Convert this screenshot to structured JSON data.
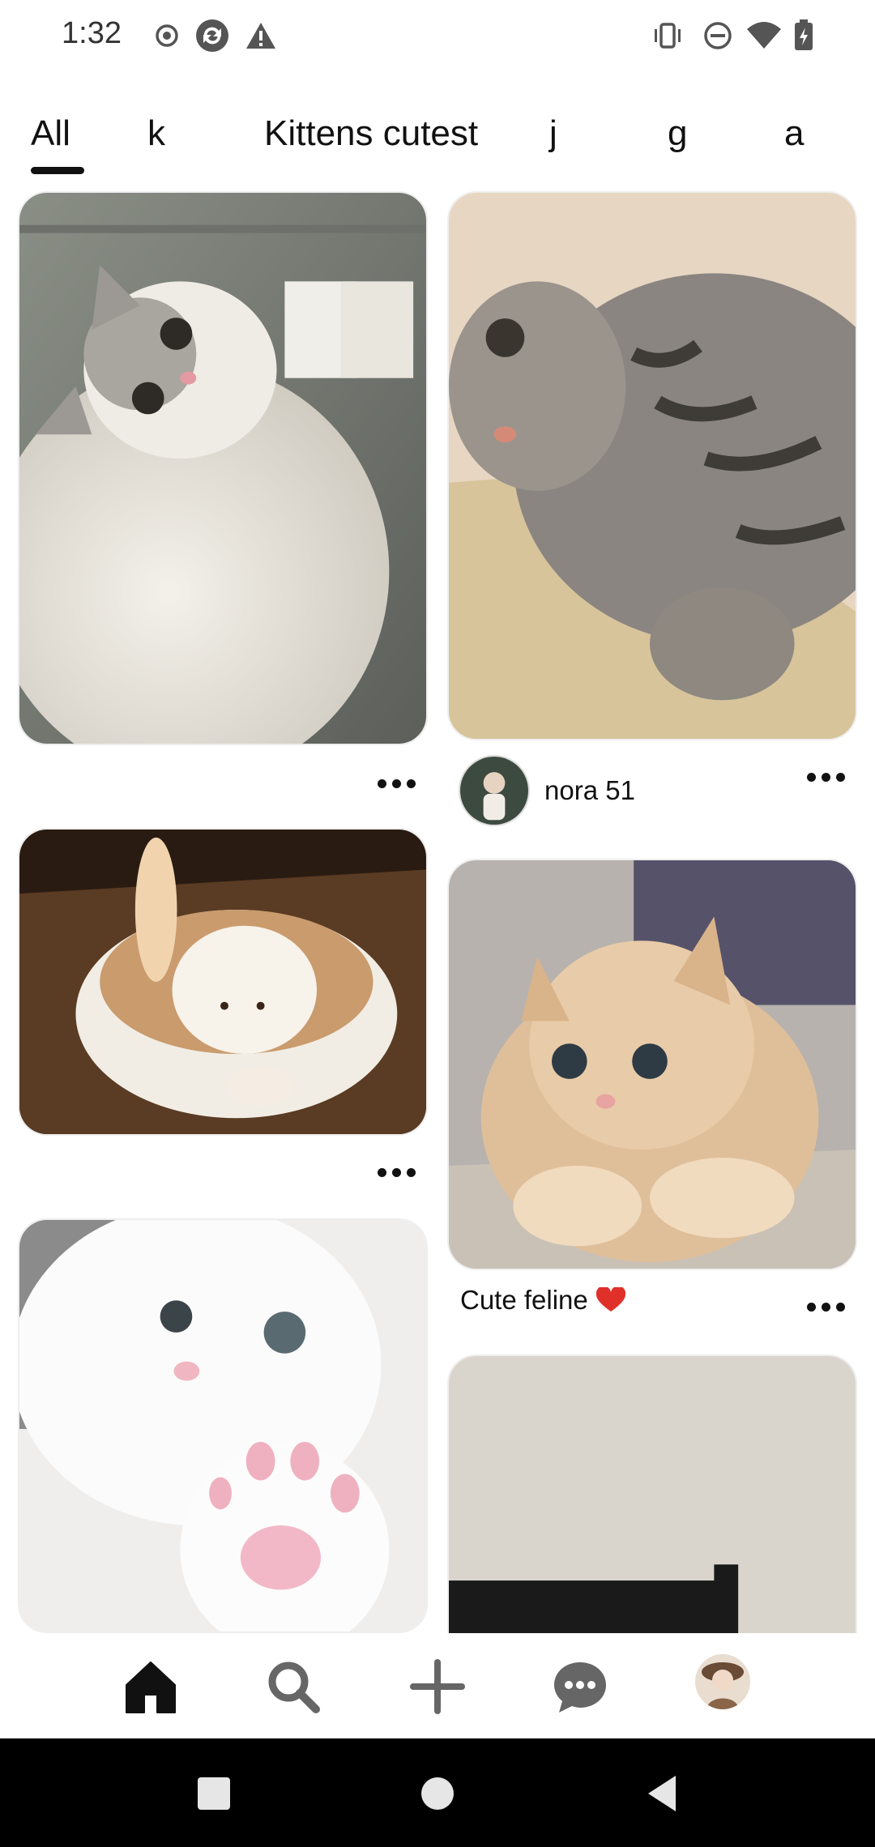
{
  "status_bar": {
    "time": "1:32",
    "left_icons": [
      "record-icon",
      "sync-icon",
      "alert-icon"
    ],
    "right_icons": [
      "vibrate-icon",
      "dnd-icon",
      "wifi-icon",
      "battery-icon"
    ]
  },
  "tabs": [
    {
      "label": "All",
      "selected": true
    },
    {
      "label": "k",
      "selected": false
    },
    {
      "label": "Kittens cutest",
      "selected": false
    },
    {
      "label": "j",
      "selected": false
    },
    {
      "label": "g",
      "selected": false
    },
    {
      "label": "a",
      "selected": false
    }
  ],
  "pins": [
    {
      "id": "pin-1",
      "image": "fluffy-gray-white-cat-photo"
    },
    {
      "id": "pin-2",
      "image": "tabby-cat-on-scratcher-photo",
      "author": "nora 51"
    },
    {
      "id": "pin-3",
      "image": "latte-art-cat-photo"
    },
    {
      "id": "pin-4",
      "image": "fluffy-orange-kitten-photo",
      "caption": "Cute feline"
    },
    {
      "id": "pin-5",
      "image": "white-cat-paw-photo"
    },
    {
      "id": "pin-6",
      "image": "room-corner-photo"
    }
  ],
  "bottom_nav": [
    {
      "name": "home",
      "icon": "home-icon",
      "active": true
    },
    {
      "name": "search",
      "icon": "search-icon",
      "active": false
    },
    {
      "name": "create",
      "icon": "plus-icon",
      "active": false
    },
    {
      "name": "messages",
      "icon": "chat-icon",
      "active": false
    },
    {
      "name": "profile",
      "icon": "profile-avatar-icon",
      "active": false
    }
  ],
  "system_nav": [
    "recents-button",
    "home-button",
    "back-button"
  ],
  "colors": {
    "text": "#111111",
    "heart": "#e0302a",
    "system_nav_bg": "#000000"
  }
}
